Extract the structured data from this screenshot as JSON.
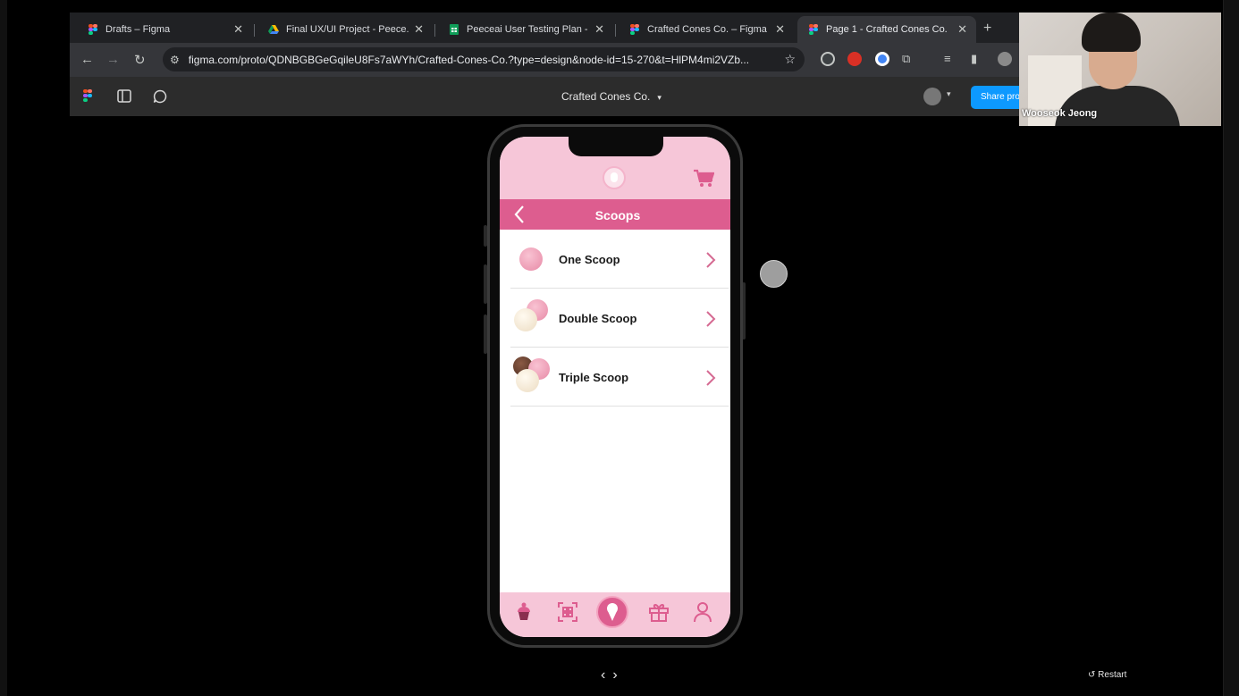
{
  "browser": {
    "tabs": [
      {
        "title": "Drafts – Figma",
        "icon": "figma-icon"
      },
      {
        "title": "Final UX/UI Project - Peece.a",
        "icon": "google-drive-icon"
      },
      {
        "title": "Peeceai User Testing Plan - G",
        "icon": "google-sheets-icon"
      },
      {
        "title": "Crafted Cones Co. – Figma",
        "icon": "figma-icon"
      },
      {
        "title": "Page 1 - Crafted Cones Co.",
        "icon": "figma-icon"
      }
    ],
    "new_tab": "+",
    "url": "figma.com/proto/QDNBGBGeGqileU8Fs7aWYh/Crafted-Cones-Co.?type=design&node-id=15-270&t=HlPM4mi2VZb..."
  },
  "figma": {
    "file_title": "Crafted Cones Co.",
    "share_label": "Share pro"
  },
  "webcam": {
    "name": "Wooseok Jeong"
  },
  "app": {
    "title": "Scoops",
    "items": [
      {
        "label": "One Scoop"
      },
      {
        "label": "Double Scoop"
      },
      {
        "label": "Triple Scoop"
      }
    ],
    "colors": {
      "header_pink": "#f6c6d8",
      "accent_pink": "#dd5d8f"
    }
  },
  "prototype_controls": {
    "prev": "‹",
    "next": "›",
    "restart_label": "Restart"
  }
}
